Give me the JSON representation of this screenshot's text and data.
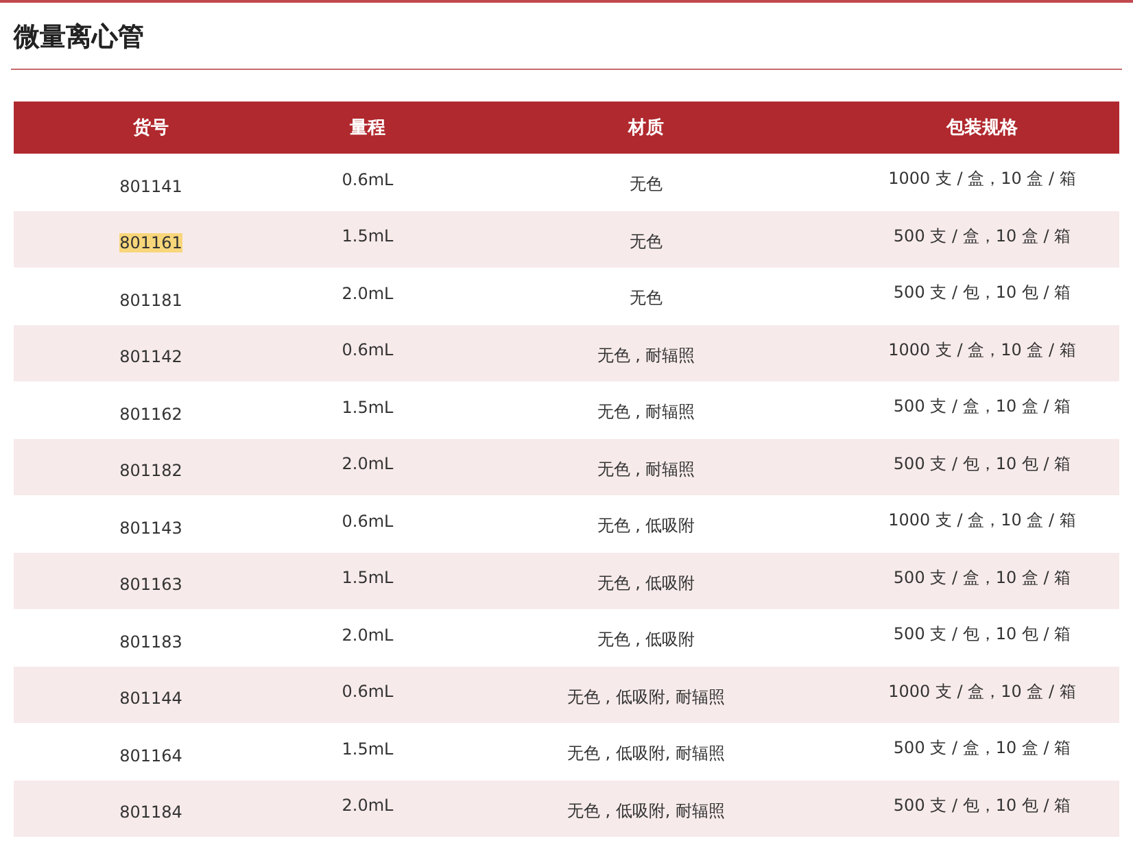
{
  "title": "微量离心管",
  "table": {
    "columns": [
      "货号",
      "量程",
      "材质",
      "包装规格"
    ],
    "rows": [
      {
        "code": "801141",
        "highlighted": false,
        "volume": "0.6mL",
        "material": "无色",
        "packing": "1000 支 / 盒，10 盒 / 箱"
      },
      {
        "code": "801161",
        "highlighted": true,
        "volume": "1.5mL",
        "material": "无色",
        "packing": "500 支 / 盒，10 盒 / 箱"
      },
      {
        "code": "801181",
        "highlighted": false,
        "volume": "2.0mL",
        "material": "无色",
        "packing": "500 支 / 包，10 包 / 箱"
      },
      {
        "code": "801142",
        "highlighted": false,
        "volume": "0.6mL",
        "material": "无色 , 耐辐照",
        "packing": "1000 支 / 盒，10 盒 / 箱"
      },
      {
        "code": "801162",
        "highlighted": false,
        "volume": "1.5mL",
        "material": "无色 , 耐辐照",
        "packing": "500 支 / 盒，10 盒 / 箱"
      },
      {
        "code": "801182",
        "highlighted": false,
        "volume": "2.0mL",
        "material": "无色 , 耐辐照",
        "packing": "500 支 / 包，10 包 / 箱"
      },
      {
        "code": "801143",
        "highlighted": false,
        "volume": "0.6mL",
        "material": "无色 , 低吸附",
        "packing": "1000 支 / 盒，10 盒 / 箱"
      },
      {
        "code": "801163",
        "highlighted": false,
        "volume": "1.5mL",
        "material": "无色 , 低吸附",
        "packing": "500 支 / 盒，10 盒 / 箱"
      },
      {
        "code": "801183",
        "highlighted": false,
        "volume": "2.0mL",
        "material": "无色 , 低吸附",
        "packing": "500 支 / 包，10 包 / 箱"
      },
      {
        "code": "801144",
        "highlighted": false,
        "volume": "0.6mL",
        "material": "无色 , 低吸附, 耐辐照",
        "packing": "1000 支 / 盒，10 盒 / 箱"
      },
      {
        "code": "801164",
        "highlighted": false,
        "volume": "1.5mL",
        "material": "无色 , 低吸附, 耐辐照",
        "packing": "500 支 / 盒，10 盒 / 箱"
      },
      {
        "code": "801184",
        "highlighted": false,
        "volume": "2.0mL",
        "material": "无色 , 低吸附, 耐辐照",
        "packing": "500 支 / 包，10 包 / 箱"
      }
    ]
  }
}
